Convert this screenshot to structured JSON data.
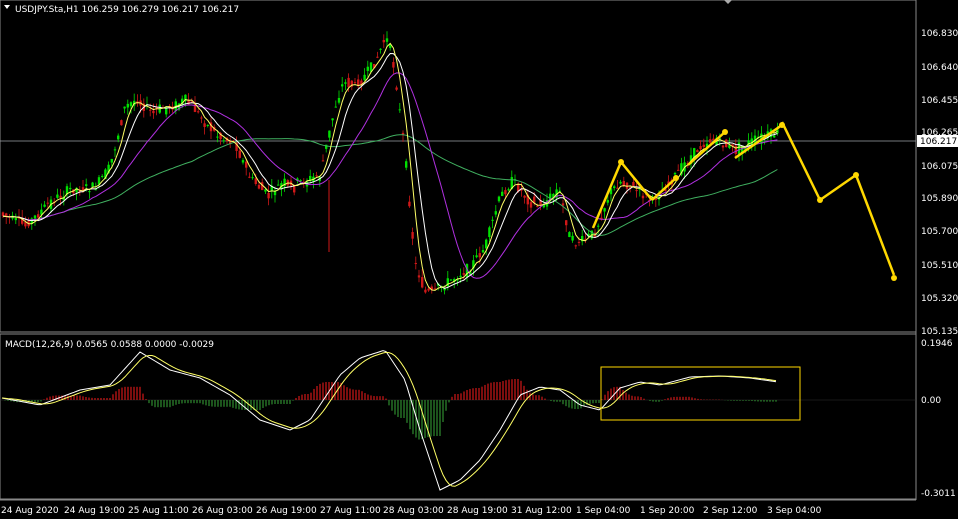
{
  "main": {
    "symbol_header": "USDJPY.Sta,H1  106.259 106.279 106.217 106.217",
    "price_ticks": [
      "106.830",
      "106.640",
      "106.455",
      "106.265",
      "106.075",
      "105.890",
      "105.700",
      "105.510",
      "105.320",
      "105.135"
    ],
    "current_price": "106.217"
  },
  "macd": {
    "header": "MACD(12,26,9) 0.0565 0.0588 0.0000 -0.0029",
    "ticks": [
      "0.1946",
      "0.00",
      "-0.3011"
    ]
  },
  "time_axis": [
    "24 Aug 2020",
    "24 Aug 19:00",
    "25 Aug 11:00",
    "26 Aug 03:00",
    "26 Aug 19:00",
    "27 Aug 11:00",
    "28 Aug 03:00",
    "28 Aug 19:00",
    "31 Aug 12:00",
    "1 Sep 04:00",
    "1 Sep 20:00",
    "2 Sep 12:00",
    "3 Sep 04:00"
  ],
  "colors": {
    "background": "#000000",
    "bull_candle": "#00e000",
    "bear_candle": "#d01818",
    "ma_fast": "#ffff66",
    "ma_mid": "#ffffff",
    "ma_slow": "#b030e0",
    "ma_long": "#40b060",
    "annotation": "#ffd800",
    "hist_pos": "#d01818",
    "hist_neg": "#2e8b2e"
  }
}
